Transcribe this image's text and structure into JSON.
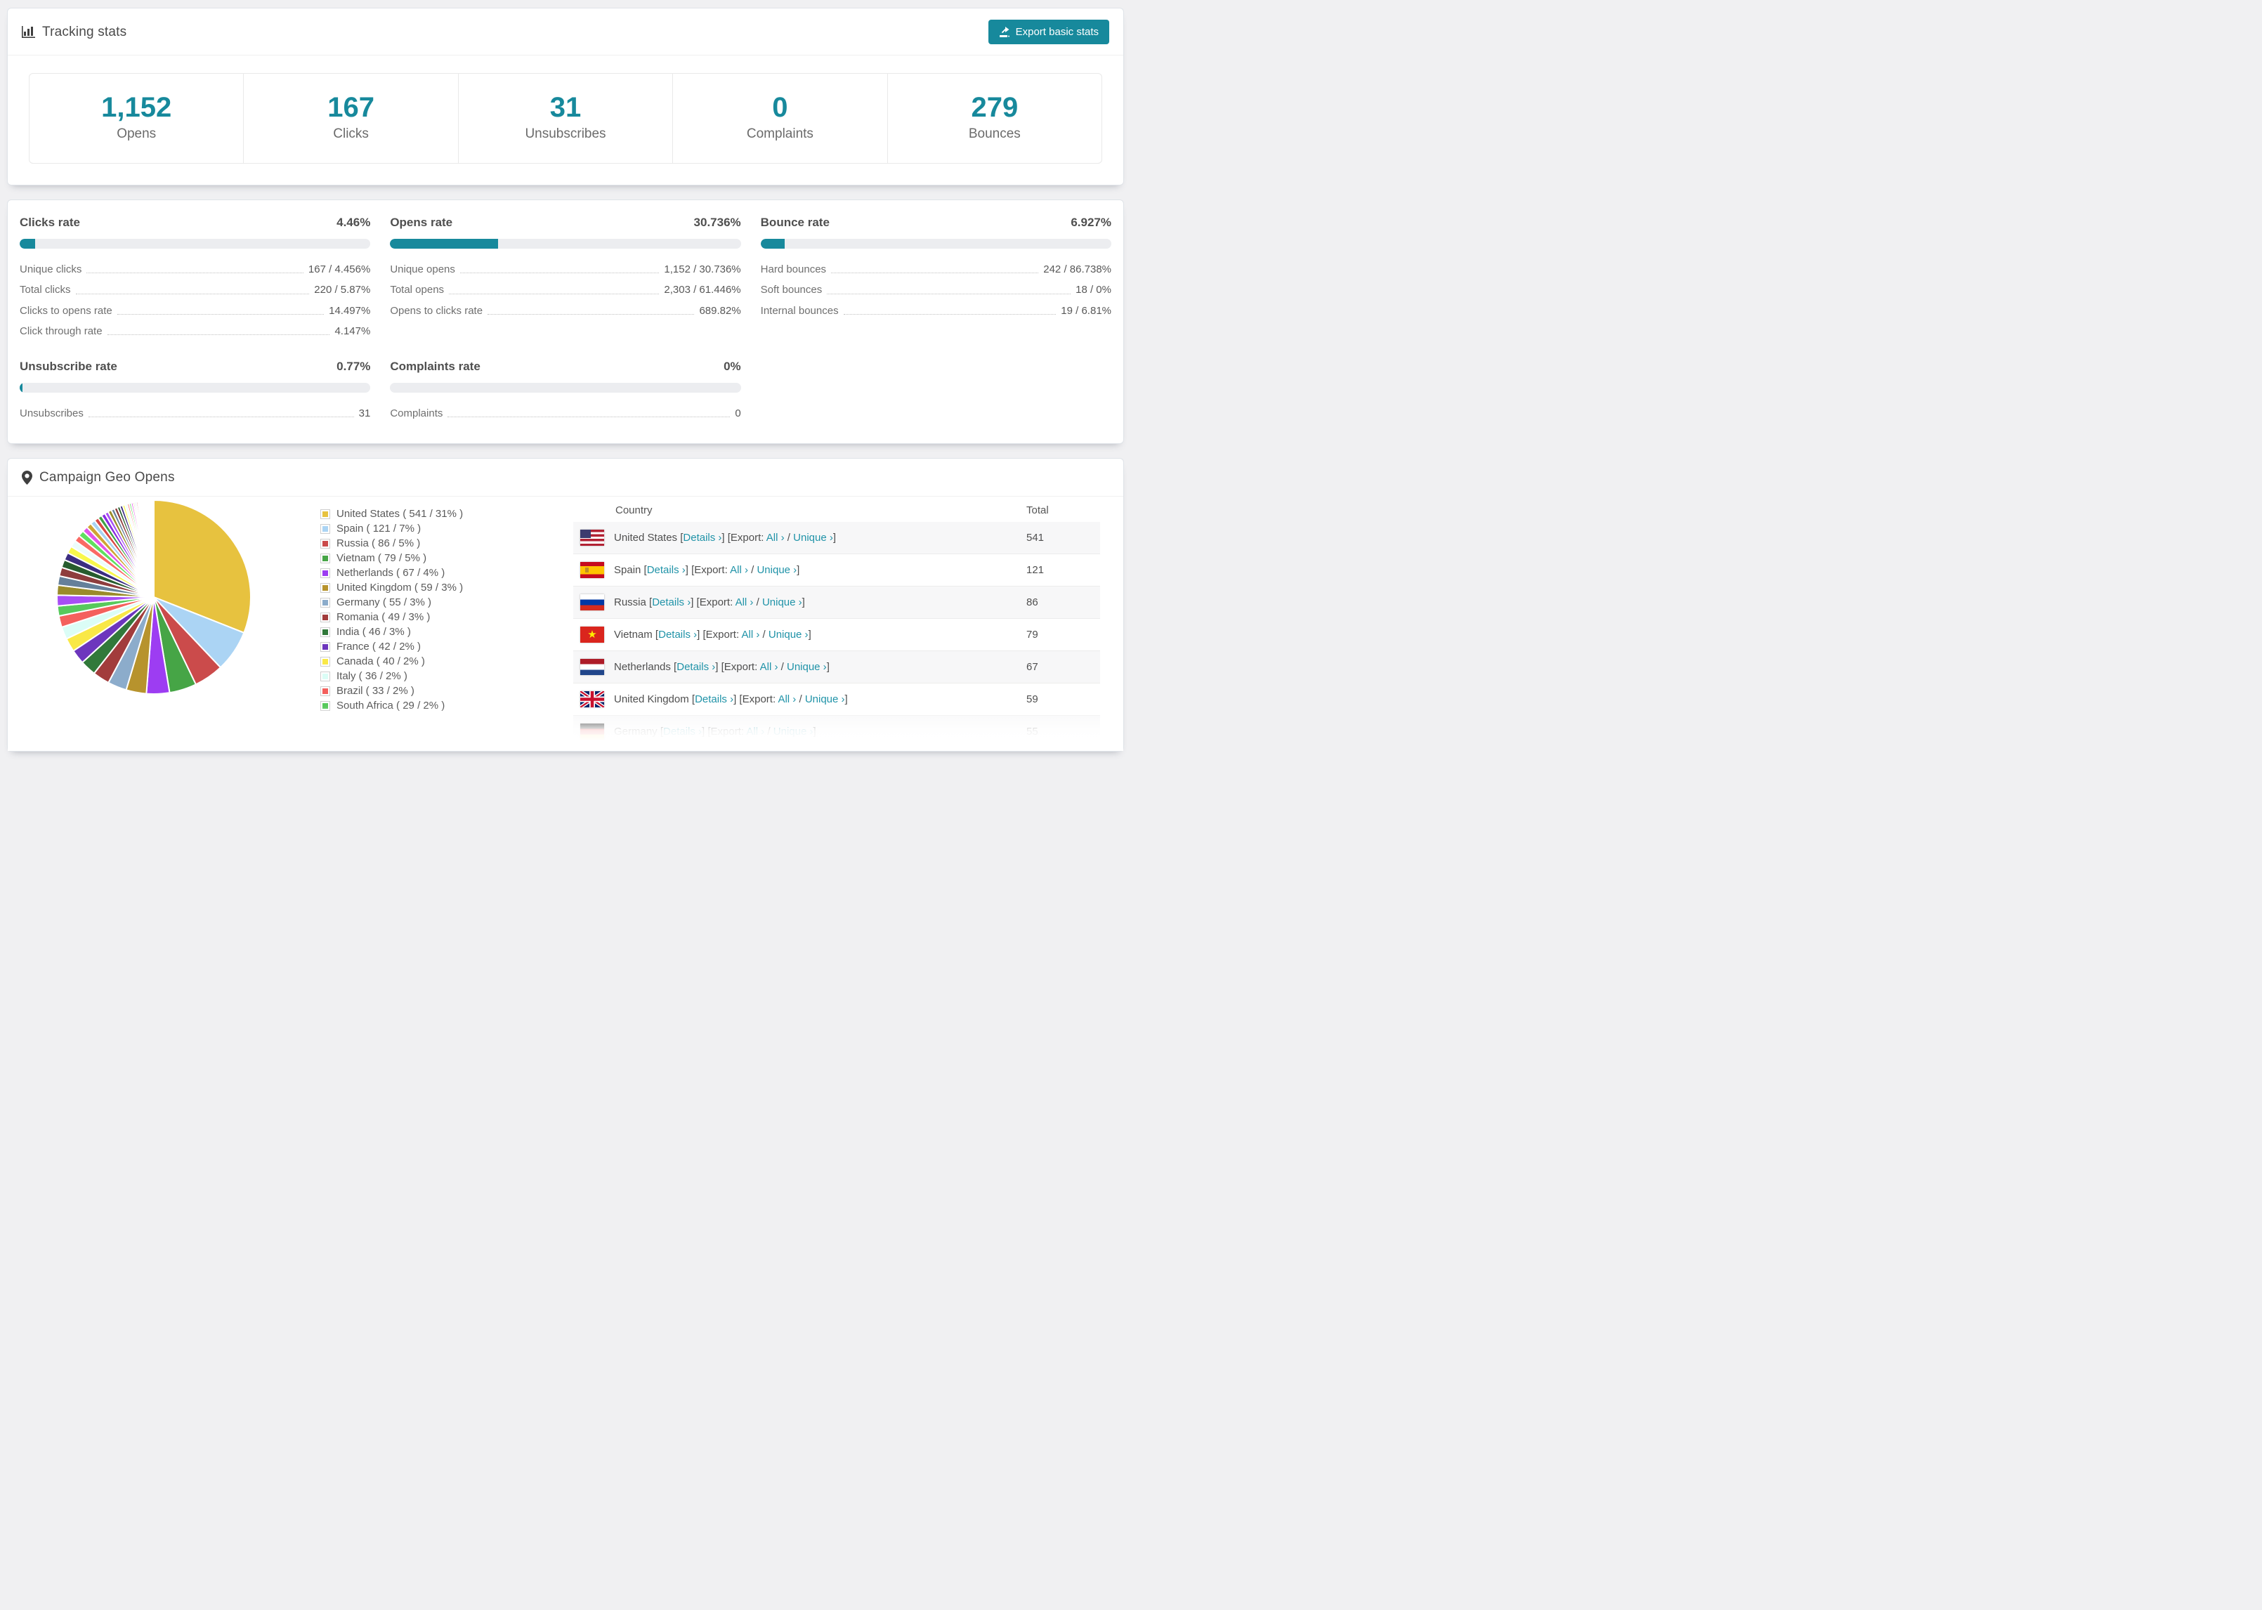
{
  "accent": "#17899c",
  "link_color": "#2093a8",
  "page_bg": "#f0f0f2",
  "tracking": {
    "title": "Tracking stats",
    "export_button": "Export basic stats",
    "stats": [
      {
        "value": "1,152",
        "label": "Opens"
      },
      {
        "value": "167",
        "label": "Clicks"
      },
      {
        "value": "31",
        "label": "Unsubscribes"
      },
      {
        "value": "0",
        "label": "Complaints"
      },
      {
        "value": "279",
        "label": "Bounces"
      }
    ]
  },
  "rates": [
    {
      "title": "Clicks rate",
      "value": "4.46%",
      "pct": 4.46,
      "rows": [
        {
          "label": "Unique clicks",
          "value": "167 / 4.456%"
        },
        {
          "label": "Total clicks",
          "value": "220 / 5.87%"
        },
        {
          "label": "Clicks to opens rate",
          "value": "14.497%"
        },
        {
          "label": "Click through rate",
          "value": "4.147%"
        }
      ]
    },
    {
      "title": "Opens rate",
      "value": "30.736%",
      "pct": 30.736,
      "rows": [
        {
          "label": "Unique opens",
          "value": "1,152 / 30.736%"
        },
        {
          "label": "Total opens",
          "value": "2,303 / 61.446%"
        },
        {
          "label": "Opens to clicks rate",
          "value": "689.82%"
        }
      ]
    },
    {
      "title": "Bounce rate",
      "value": "6.927%",
      "pct": 6.927,
      "rows": [
        {
          "label": "Hard bounces",
          "value": "242 / 86.738%"
        },
        {
          "label": "Soft bounces",
          "value": "18 / 0%"
        },
        {
          "label": "Internal bounces",
          "value": "19 / 6.81%"
        }
      ]
    },
    {
      "title": "Unsubscribe rate",
      "value": "0.77%",
      "pct": 0.77,
      "rows": [
        {
          "label": "Unsubscribes",
          "value": "31"
        }
      ]
    },
    {
      "title": "Complaints rate",
      "value": "0%",
      "pct": 0,
      "rows": [
        {
          "label": "Complaints",
          "value": "0"
        }
      ]
    }
  ],
  "geo": {
    "title": "Campaign Geo Opens",
    "columns": [
      "Country",
      "Total"
    ],
    "links": {
      "details": "Details ›",
      "export_prefix": "[Export:",
      "all": "All ›",
      "divider": "/",
      "unique": "Unique ›"
    },
    "rows": [
      {
        "country": "United States",
        "flag": "us",
        "total": "541",
        "partially_visible": false
      },
      {
        "country": "Spain",
        "flag": "es",
        "total": "121",
        "partially_visible": false
      },
      {
        "country": "Russia",
        "flag": "ru",
        "total": "86",
        "partially_visible": false
      },
      {
        "country": "Vietnam",
        "flag": "vn",
        "total": "79",
        "partially_visible": false
      },
      {
        "country": "Netherlands",
        "flag": "nl",
        "total": "67",
        "partially_visible": false
      },
      {
        "country": "United Kingdom",
        "flag": "gb",
        "total": "59",
        "partially_visible": false
      },
      {
        "country": "Germany",
        "flag": "de",
        "total": "55",
        "partially_visible": true
      }
    ]
  },
  "chart_data": {
    "type": "pie",
    "title": "Campaign Geo Opens",
    "legend_position": "right",
    "start_angle_deg": -90,
    "slices": [
      {
        "label": "United States",
        "value": 541,
        "pct": 31,
        "color": "#e7c23f"
      },
      {
        "label": "Spain",
        "value": 121,
        "pct": 7,
        "color": "#abd4f4"
      },
      {
        "label": "Russia",
        "value": 86,
        "pct": 5,
        "color": "#cb4b4b"
      },
      {
        "label": "Vietnam",
        "value": 79,
        "pct": 5,
        "color": "#46a546"
      },
      {
        "label": "Netherlands",
        "value": 67,
        "pct": 4,
        "color": "#9d3df2"
      },
      {
        "label": "United Kingdom",
        "value": 59,
        "pct": 3,
        "color": "#b7932d"
      },
      {
        "label": "Germany",
        "value": 55,
        "pct": 3,
        "color": "#8caccb"
      },
      {
        "label": "Romania",
        "value": 49,
        "pct": 3,
        "color": "#a23c3c"
      },
      {
        "label": "India",
        "value": 46,
        "pct": 3,
        "color": "#31793a"
      },
      {
        "label": "France",
        "value": 42,
        "pct": 2,
        "color": "#6d36bd"
      },
      {
        "label": "Canada",
        "value": 40,
        "pct": 2,
        "color": "#f9e847"
      },
      {
        "label": "Italy",
        "value": 36,
        "pct": 2,
        "color": "#dbfdf6"
      },
      {
        "label": "Brazil",
        "value": 33,
        "pct": 2,
        "color": "#f4605d"
      },
      {
        "label": "South Africa",
        "value": 29,
        "pct": 2,
        "color": "#57c95c"
      }
    ],
    "others": {
      "note": "many small unlabeled country slices",
      "total": 462,
      "weights": [
        27,
        25,
        23,
        22,
        20,
        19,
        18,
        17,
        16,
        15,
        14,
        13,
        12,
        11,
        10,
        10,
        9,
        9,
        8,
        8,
        7,
        7,
        6,
        6,
        5,
        5,
        5,
        4,
        4,
        4,
        3,
        3,
        3,
        3,
        2.5,
        2.5,
        2,
        2,
        2,
        2,
        1.5,
        1.5,
        1.5,
        1,
        1,
        1,
        1,
        1,
        0.8,
        0.8,
        0.6,
        0.6,
        0.5,
        0.5,
        0.4,
        0.4,
        0.3,
        0.3,
        0.25,
        0.2
      ],
      "palette": [
        "#a74ef5",
        "#9a8b2a",
        "#65809a",
        "#8e3d3d",
        "#275c2e",
        "#3c2d80",
        "#f8f84b",
        "#ecfdfb",
        "#fa6a64",
        "#5fe05f",
        "#e255ea",
        "#cfa433",
        "#a8d3f2",
        "#d94743",
        "#3fa046",
        "#8a2be2"
      ]
    }
  }
}
